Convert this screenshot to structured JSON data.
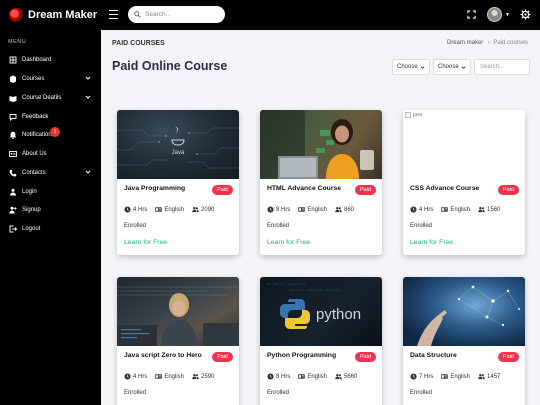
{
  "brand": {
    "name": "Dream Maker"
  },
  "search": {
    "placeholder": "Search..."
  },
  "sidebar": {
    "menu_title": "MENU",
    "items": [
      {
        "label": "Dashboard",
        "icon": "grid-icon"
      },
      {
        "label": "Courses",
        "icon": "book-icon",
        "chevron": true
      },
      {
        "label": "Course Deatils",
        "icon": "book-open-icon",
        "chevron": true
      },
      {
        "label": "Feedback",
        "icon": "chat-icon"
      },
      {
        "label": "Notification",
        "icon": "bell-icon",
        "badge": "1"
      },
      {
        "label": "About Us",
        "icon": "id-card-icon"
      },
      {
        "label": "Contacts",
        "icon": "phone-icon",
        "chevron": true
      },
      {
        "label": "Login",
        "icon": "login-icon"
      },
      {
        "label": "Signup",
        "icon": "user-plus-icon"
      },
      {
        "label": "Logout",
        "icon": "logout-icon"
      }
    ]
  },
  "header": {
    "section": "PAID COURSES",
    "breadcrumb": [
      "Dream maker",
      "Paid courses"
    ],
    "page_title": "Paid Online Course",
    "filters": [
      "Choose",
      "Choose"
    ],
    "filter_search_placeholder": "Search..."
  },
  "cards": [
    {
      "title": "Java Programming",
      "badge": "Paid",
      "hours": "4 Hrs",
      "language": "English",
      "enrolled_count": "2090",
      "enrolled_label": "Enrolled",
      "cta": "Learn for Free",
      "image": "java-image"
    },
    {
      "title": "HTML Advance Course",
      "badge": "Paid",
      "hours": "8 Hrs",
      "language": "English",
      "enrolled_count": "860",
      "enrolled_label": "Enrolled",
      "cta": "Learn for Free",
      "image": "woman-laptop-image"
    },
    {
      "title": "CSS Advance Course",
      "badge": "Paid",
      "hours": "4 Hrs",
      "language": "English",
      "enrolled_count": "1560",
      "enrolled_label": "Enrolled",
      "cta": "Learn for Free",
      "image": "broken-image",
      "alt": "java"
    },
    {
      "title": "Java script Zero to Hero",
      "badge": "Paid",
      "hours": "4 Hrs",
      "language": "English",
      "enrolled_count": "2590",
      "enrolled_label": "Enrolled",
      "cta": "",
      "image": "coding-woman-image"
    },
    {
      "title": "Python Programming",
      "badge": "Paid",
      "hours": "8 Hrs",
      "language": "English",
      "enrolled_count": "5660",
      "enrolled_label": "Enrolled",
      "cta": "",
      "image": "python-image",
      "image_text": "python"
    },
    {
      "title": "Data Structure",
      "badge": "Paid",
      "hours": "7 Hrs",
      "language": "English",
      "enrolled_count": "1457",
      "enrolled_label": "Enrolled",
      "cta": "",
      "image": "network-hand-image"
    }
  ],
  "colors": {
    "badge": "#f0344f",
    "cta": "#1fae7f",
    "topbar": "#000000"
  }
}
